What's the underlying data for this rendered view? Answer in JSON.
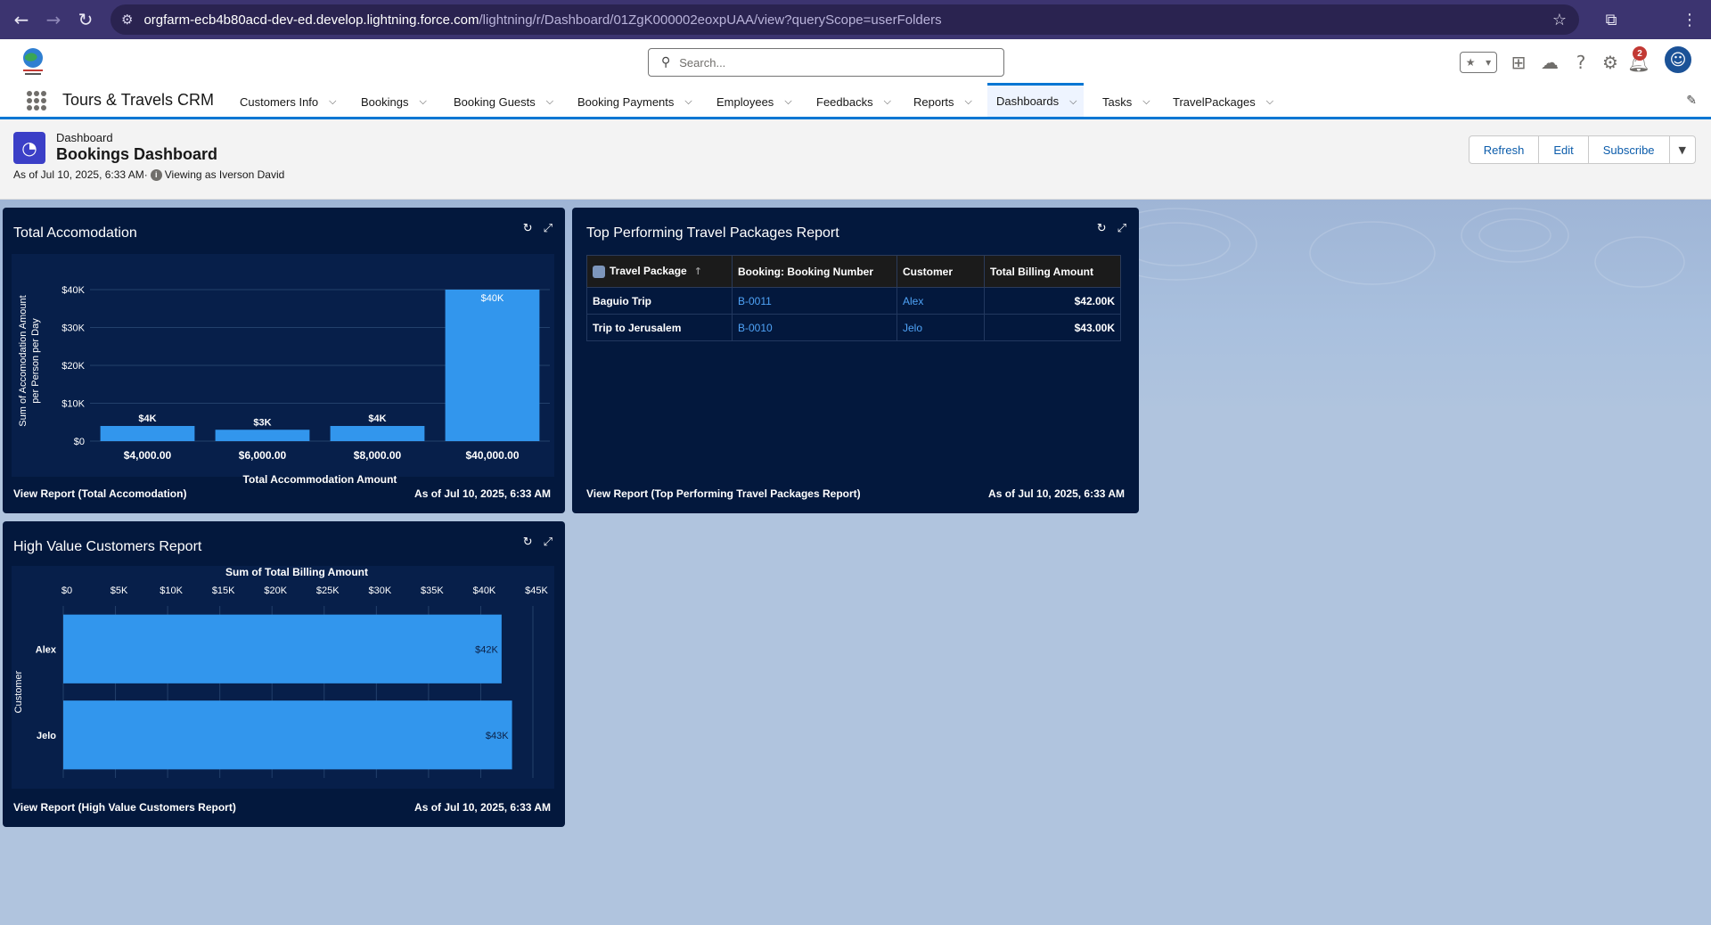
{
  "browser": {
    "url_host": "orgfarm-ecb4b80acd-dev-ed.develop.lightning.force.com",
    "url_path": "/lightning/r/Dashboard/01ZgK000002eoxpUAA/view?queryScope=userFolders"
  },
  "header": {
    "search_placeholder": "Search...",
    "notification_count": "2"
  },
  "nav": {
    "app_name": "Tours & Travels CRM",
    "items": [
      {
        "label": "Customers Info"
      },
      {
        "label": "Bookings"
      },
      {
        "label": "Booking Guests"
      },
      {
        "label": "Booking Payments"
      },
      {
        "label": "Employees"
      },
      {
        "label": "Feedbacks"
      },
      {
        "label": "Reports"
      },
      {
        "label": "Dashboards"
      },
      {
        "label": "Tasks"
      },
      {
        "label": "TravelPackages"
      }
    ]
  },
  "dashboard": {
    "object_label": "Dashboard",
    "title": "Bookings Dashboard",
    "as_of": "As of Jul 10, 2025, 6:33 AM·",
    "viewing_as": "Viewing as Iverson David",
    "buttons": {
      "refresh": "Refresh",
      "edit": "Edit",
      "subscribe": "Subscribe"
    }
  },
  "widgets": {
    "accomodation": {
      "title": "Total Accomodation",
      "footer_link": "View Report (Total Accomodation)",
      "footer_date": "As of Jul 10, 2025, 6:33 AM"
    },
    "top_packages": {
      "title": "Top Performing Travel Packages Report",
      "footer_link": "View Report (Top Performing Travel Packages Report)",
      "footer_date": "As of Jul 10, 2025, 6:33 AM",
      "columns": [
        "Travel Package",
        "Booking: Booking Number",
        "Customer",
        "Total Billing Amount"
      ],
      "rows": [
        {
          "package": "Baguio Trip",
          "booking": "B-0011",
          "customer": "Alex",
          "amount": "$42.00K"
        },
        {
          "package": "Trip to Jerusalem",
          "booking": "B-0010",
          "customer": "Jelo",
          "amount": "$43.00K"
        }
      ]
    },
    "high_value": {
      "title": "High Value Customers Report",
      "footer_link": "View Report (High Value Customers Report)",
      "footer_date": "As of Jul 10, 2025, 6:33 AM"
    }
  },
  "chart_data": [
    {
      "type": "bar",
      "title": "Total Accomodation",
      "xlabel": "Total Accommodation Amount",
      "ylabel": "Sum of Accomodation Amount per Person per Day",
      "categories": [
        "$4,000.00",
        "$6,000.00",
        "$8,000.00",
        "$40,000.00"
      ],
      "values": [
        4000,
        3000,
        4000,
        40000
      ],
      "data_labels": [
        "$4K",
        "$3K",
        "$4K",
        "$40K"
      ],
      "ylim": [
        0,
        40000
      ],
      "yticks": [
        "$0",
        "$10K",
        "$20K",
        "$30K",
        "$40K"
      ],
      "ytick_values": [
        0,
        10000,
        20000,
        30000,
        40000
      ],
      "color": "#3296ed",
      "grid": true
    },
    {
      "type": "bar",
      "orientation": "horizontal",
      "title": "High Value Customers Report",
      "xlabel": "Sum of Total Billing Amount",
      "ylabel": "Customer",
      "categories": [
        "Alex",
        "Jelo"
      ],
      "values": [
        42000,
        43000
      ],
      "data_labels": [
        "$42K",
        "$43K"
      ],
      "xlim": [
        0,
        45000
      ],
      "xticks": [
        "$0",
        "$5K",
        "$10K",
        "$15K",
        "$20K",
        "$25K",
        "$30K",
        "$35K",
        "$40K",
        "$45K"
      ],
      "xtick_values": [
        0,
        5000,
        10000,
        15000,
        20000,
        25000,
        30000,
        35000,
        40000,
        45000
      ],
      "color": "#3296ed",
      "grid": true
    }
  ]
}
